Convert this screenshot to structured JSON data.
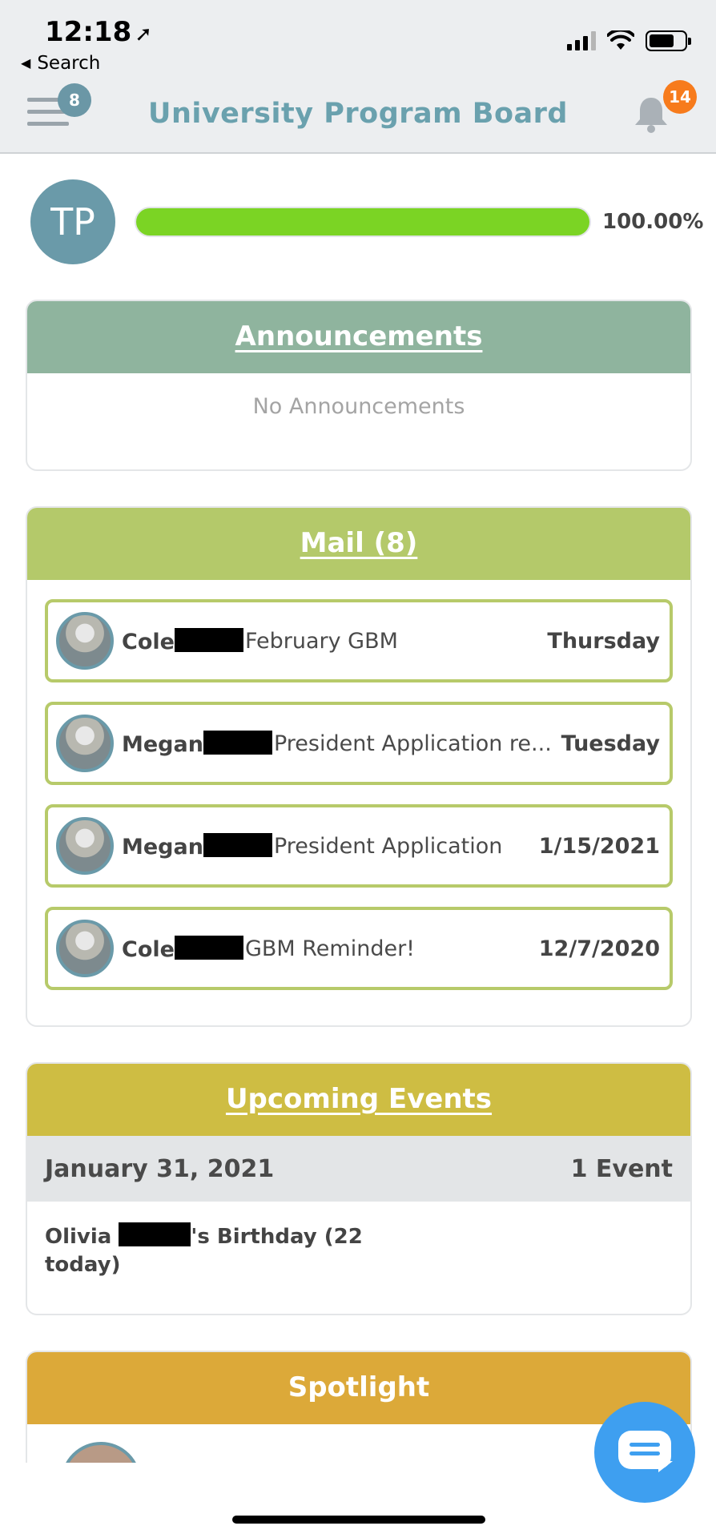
{
  "status_bar": {
    "time": "12:18",
    "back_label": "Search"
  },
  "header": {
    "title": "University Program Board",
    "menu_badge": "8",
    "notification_badge": "14"
  },
  "profile": {
    "initials": "TP",
    "progress_text": "100.00%",
    "progress_fraction": 1.0
  },
  "announcements": {
    "title": "Announcements",
    "empty_text": "No Announcements"
  },
  "mail": {
    "title": "Mail (8)",
    "items": [
      {
        "sender": "Cole",
        "subject": "February GBM",
        "date": "Thursday"
      },
      {
        "sender": "Megan",
        "subject": "President Application re...",
        "date": "Tuesday"
      },
      {
        "sender": "Megan",
        "subject": "President Application",
        "date": "1/15/2021"
      },
      {
        "sender": "Cole",
        "subject": "GBM Reminder!",
        "date": "12/7/2020"
      }
    ]
  },
  "events": {
    "title": "Upcoming Events",
    "day": {
      "date": "January 31, 2021",
      "count": "1 Event"
    },
    "items": [
      {
        "name_start": "Olivia ",
        "name_end": "'s Birthday (22 today)"
      }
    ]
  },
  "spotlight": {
    "title": "Spotlight"
  },
  "colors": {
    "accent": "#6aa1ae",
    "progress": "#7bd424",
    "announcements": "#8fb49e",
    "mail": "#b4c96a",
    "events": "#cebd43",
    "spotlight": "#dca939",
    "badge": "#f77b1c",
    "chat": "#3e9ff0"
  },
  "icons": [
    "location-arrow-icon",
    "back-triangle-icon",
    "signal-icon",
    "wifi-icon",
    "battery-icon",
    "hamburger-menu-icon",
    "bell-icon",
    "chat-icon"
  ]
}
